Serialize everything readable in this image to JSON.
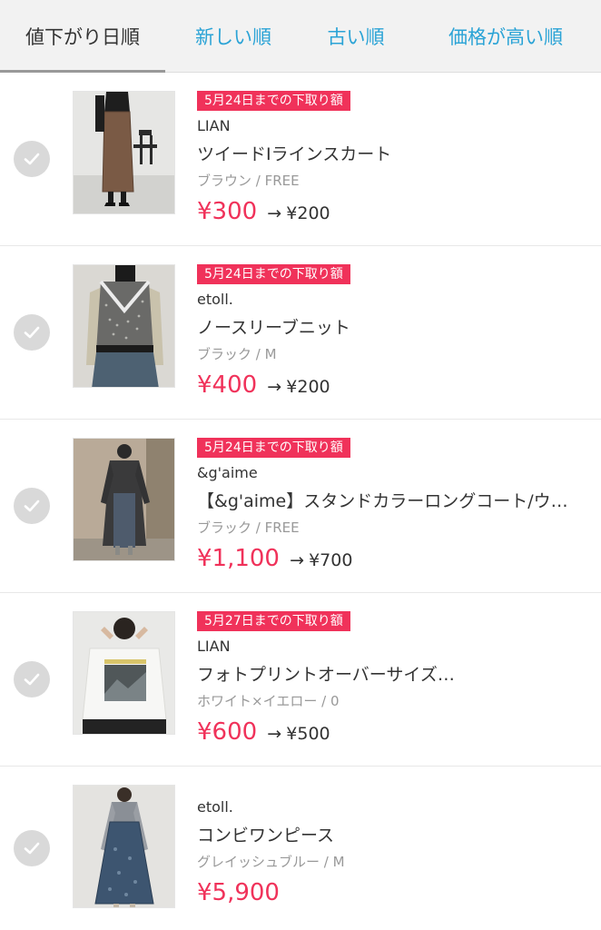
{
  "tabs": [
    {
      "label": "値下がり日順",
      "active": true
    },
    {
      "label": "新しい順",
      "active": false
    },
    {
      "label": "古い順",
      "active": false
    },
    {
      "label": "価格が高い順",
      "active": false
    }
  ],
  "colors": {
    "accent": "#f0325a",
    "tab_link": "#2aa3d6",
    "check_bg": "#d9d9d9"
  },
  "items": [
    {
      "badge": "5月24日までの下取り額",
      "brand": "LIAN",
      "name": "ツイードIラインスカート",
      "variant": "ブラウン / FREE",
      "price": "¥300",
      "arrow": "→",
      "new_price": "¥200"
    },
    {
      "badge": "5月24日までの下取り額",
      "brand": "etoll.",
      "name": "ノースリーブニット",
      "variant": "ブラック / M",
      "price": "¥400",
      "arrow": "→",
      "new_price": "¥200"
    },
    {
      "badge": "5月24日までの下取り額",
      "brand": "&g'aime",
      "name": "【&g'aime】スタンドカラーロングコート/ウ…",
      "variant": "ブラック / FREE",
      "price": "¥1,100",
      "arrow": "→",
      "new_price": "¥700"
    },
    {
      "badge": "5月27日までの下取り額",
      "brand": "LIAN",
      "name": "フォトプリントオーバーサイズ…",
      "variant": "ホワイト×イエロー / 0",
      "price": "¥600",
      "arrow": "→",
      "new_price": "¥500"
    },
    {
      "badge": "",
      "brand": "etoll.",
      "name": "コンビワンピース",
      "variant": "グレイッシュブルー / M",
      "price": "¥5,900",
      "arrow": "",
      "new_price": ""
    }
  ]
}
